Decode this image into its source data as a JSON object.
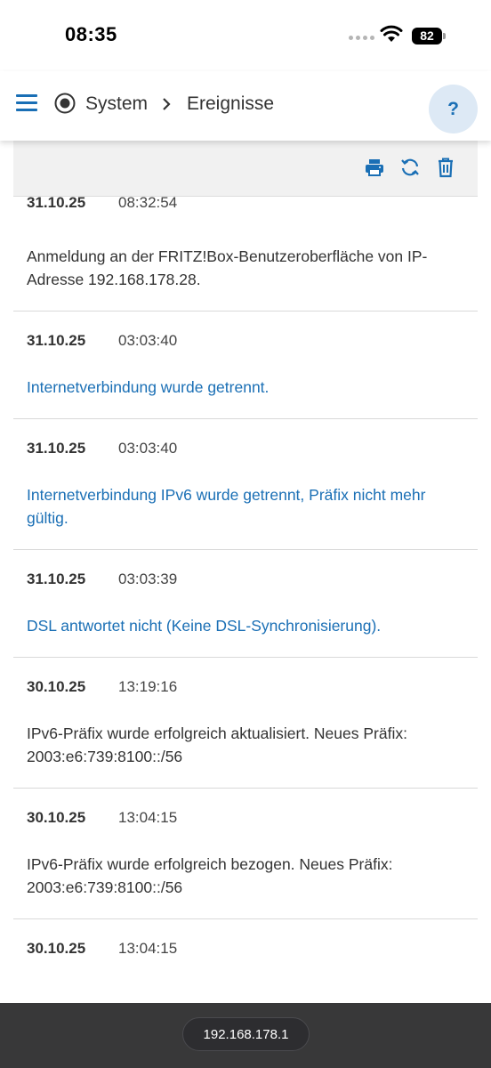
{
  "status_bar": {
    "time": "08:35",
    "battery": "82"
  },
  "header": {
    "breadcrumb_root": "System",
    "breadcrumb_current": "Ereignisse",
    "help_label": "?"
  },
  "toolbar": {
    "icons": [
      "printer-icon",
      "refresh-icon",
      "trash-icon"
    ]
  },
  "events": [
    {
      "date": "31.10.25",
      "time": "08:32:54",
      "message": "Anmeldung an der FRITZ!Box-Benutzeroberfläche von IP-Adresse 192.168.178.28.",
      "style": "normal"
    },
    {
      "date": "31.10.25",
      "time": "03:03:40",
      "message": "Internetverbindung wurde getrennt.",
      "style": "link"
    },
    {
      "date": "31.10.25",
      "time": "03:03:40",
      "message": "Internetverbindung IPv6 wurde getrennt, Präfix nicht mehr gültig.",
      "style": "link"
    },
    {
      "date": "31.10.25",
      "time": "03:03:39",
      "message": "DSL antwortet nicht (Keine DSL-Synchronisierung).",
      "style": "link"
    },
    {
      "date": "30.10.25",
      "time": "13:19:16",
      "message": "IPv6-Präfix wurde erfolgreich aktualisiert. Neues Präfix: 2003:e6:739:8100::/56",
      "style": "normal"
    },
    {
      "date": "30.10.25",
      "time": "13:04:15",
      "message": "IPv6-Präfix wurde erfolgreich bezogen. Neues Präfix: 2003:e6:739:8100::/56",
      "style": "normal"
    },
    {
      "date": "30.10.25",
      "time": "13:04:15",
      "message": "",
      "style": "normal"
    }
  ],
  "browser": {
    "url": "192.168.178.1"
  },
  "colors": {
    "accent": "#1a6fb5",
    "toolbar_bg": "#f1f1f1"
  }
}
